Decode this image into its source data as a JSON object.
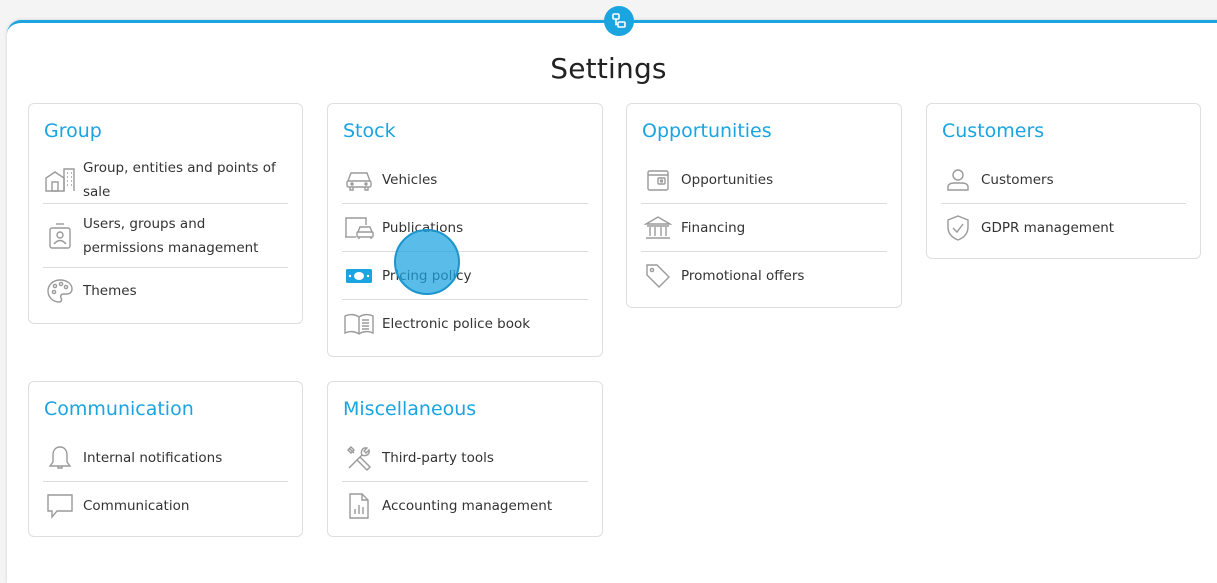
{
  "page": {
    "title": "Settings"
  },
  "colors": {
    "accent": "#1aa4e0",
    "text": "#333333",
    "icon": "#9a9a9a"
  },
  "cards": {
    "group": {
      "title": "Group",
      "items": [
        {
          "label": "Group, entities and points of sale",
          "icon": "building-icon"
        },
        {
          "label": "Users, groups and permissions management",
          "icon": "user-badge-icon"
        },
        {
          "label": "Themes",
          "icon": "palette-icon"
        }
      ]
    },
    "stock": {
      "title": "Stock",
      "items": [
        {
          "label": "Vehicles",
          "icon": "car-icon"
        },
        {
          "label": "Publications",
          "icon": "car-screen-icon"
        },
        {
          "label": "Pricing policy",
          "icon": "money-icon"
        },
        {
          "label": "Electronic police book",
          "icon": "open-book-icon"
        }
      ]
    },
    "opportunities": {
      "title": "Opportunities",
      "items": [
        {
          "label": "Opportunities",
          "icon": "wallet-icon"
        },
        {
          "label": "Financing",
          "icon": "bank-icon"
        },
        {
          "label": "Promotional offers",
          "icon": "tag-icon"
        }
      ]
    },
    "customers": {
      "title": "Customers",
      "items": [
        {
          "label": "Customers",
          "icon": "person-icon"
        },
        {
          "label": "GDPR management",
          "icon": "shield-check-icon"
        }
      ]
    },
    "communication": {
      "title": "Communication",
      "items": [
        {
          "label": "Internal notifications",
          "icon": "bell-icon"
        },
        {
          "label": "Communication",
          "icon": "chat-bubble-icon"
        }
      ]
    },
    "miscellaneous": {
      "title": "Miscellaneous",
      "items": [
        {
          "label": "Third-party tools",
          "icon": "tools-icon"
        },
        {
          "label": "Accounting management",
          "icon": "accounting-icon"
        }
      ]
    }
  }
}
